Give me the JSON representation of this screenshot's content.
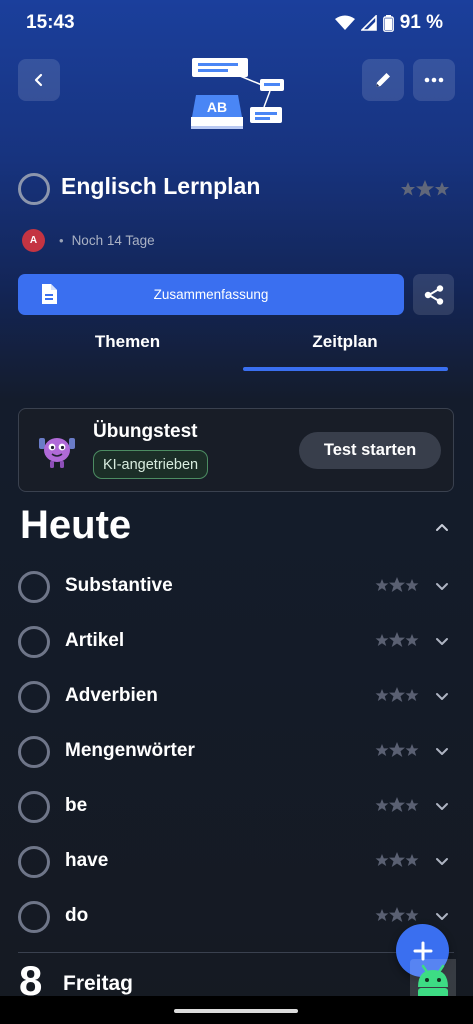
{
  "status_bar": {
    "time": "15:43",
    "battery": "91 %"
  },
  "header": {
    "back_icon": "back-arrow-icon",
    "edit_icon": "pencil-icon",
    "more_icon": "more-dots-icon",
    "hero_icon_text": "AB"
  },
  "plan": {
    "title": "Englisch Lernplan",
    "avatar_initial": "A",
    "due_text": "Noch 14 Tage",
    "summary_label": "Zusammenfassung"
  },
  "tabs": [
    {
      "label": "Themen",
      "active": false
    },
    {
      "label": "Zeitplan",
      "active": true
    }
  ],
  "practice": {
    "title": "Übungstest",
    "badge": "KI-angetrieben",
    "button": "Test starten"
  },
  "today": {
    "heading": "Heute",
    "topics": [
      {
        "label": "Substantive"
      },
      {
        "label": "Artikel"
      },
      {
        "label": "Adverbien"
      },
      {
        "label": "Mengenwörter"
      },
      {
        "label": "be"
      },
      {
        "label": "have"
      },
      {
        "label": "do"
      }
    ]
  },
  "next_day": {
    "number": "8",
    "name": "Freitag"
  },
  "colors": {
    "accent": "#3a6ff0",
    "background": "#151a22"
  }
}
